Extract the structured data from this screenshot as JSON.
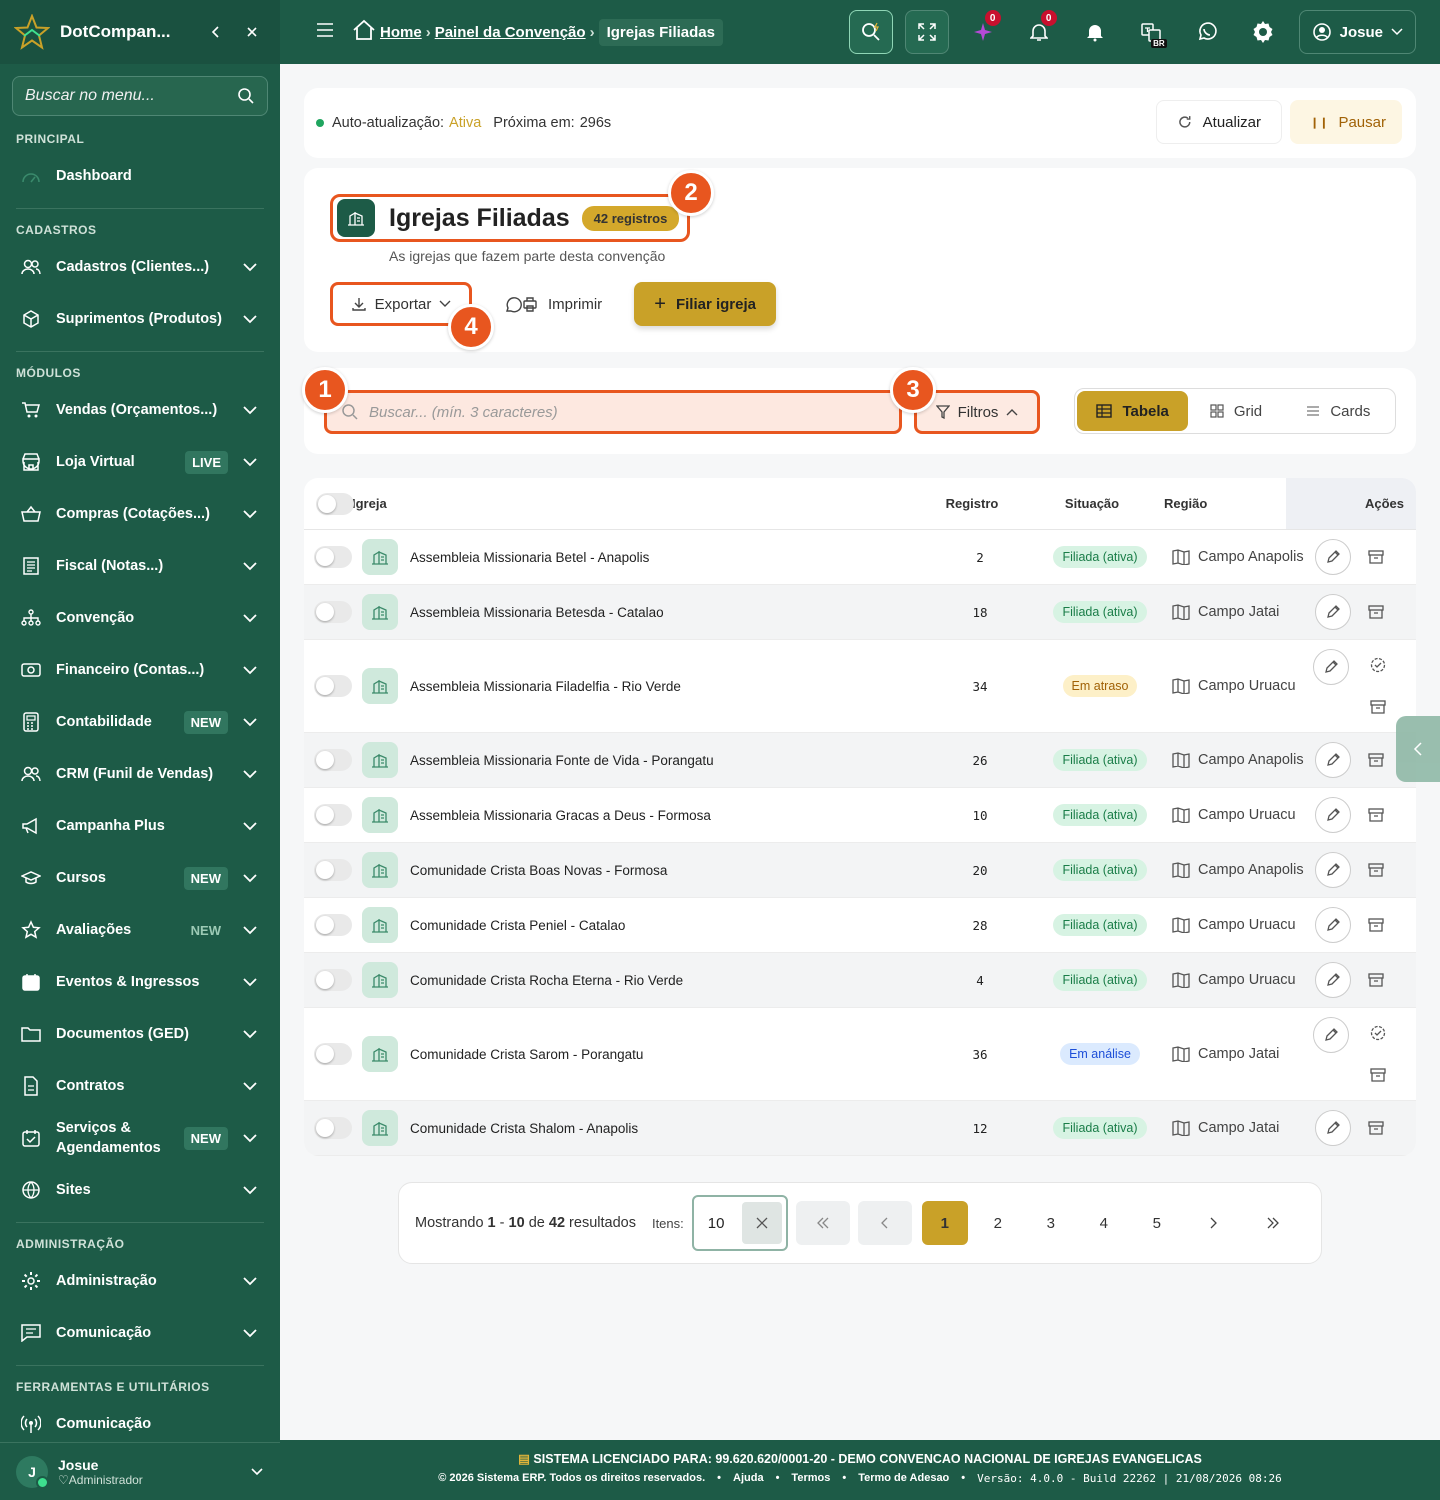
{
  "sidebar": {
    "brand": "DotCompan...",
    "search_placeholder": "Buscar no menu...",
    "sections": {
      "principal": "PRINCIPAL",
      "cadastros": "CADASTROS",
      "modulos": "MÓDULOS",
      "administracao": "ADMINISTRAÇÃO",
      "ferramentas": "FERRAMENTAS E UTILITÁRIOS"
    },
    "items": {
      "dashboard": "Dashboard",
      "cadastros": "Cadastros (Clientes...)",
      "suprimentos": "Suprimentos (Produtos)",
      "vendas": "Vendas (Orçamentos...)",
      "loja": "Loja Virtual",
      "compras": "Compras (Cotações...)",
      "fiscal": "Fiscal (Notas...)",
      "convencao": "Convenção",
      "financeiro": "Financeiro (Contas...)",
      "contabilidade": "Contabilidade",
      "crm": "CRM (Funil de Vendas)",
      "campanha": "Campanha Plus",
      "cursos": "Cursos",
      "avaliacoes": "Avaliações",
      "eventos": "Eventos & Ingressos",
      "documentos": "Documentos (GED)",
      "contratos": "Contratos",
      "servicos": "Serviços & Agendamentos",
      "sites": "Sites",
      "administracao": "Administração",
      "comunicacao": "Comunicação",
      "comunicacao2": "Comunicação"
    },
    "badges": {
      "live": "LIVE",
      "new": "NEW"
    },
    "user": {
      "initial": "J",
      "name": "Josue",
      "role": "Administrador"
    }
  },
  "topbar": {
    "breadcrumb": {
      "home": "Home",
      "painel": "Painel da Convenção",
      "current": "Igrejas Filiadas"
    },
    "counts": {
      "ai": "0",
      "notif": "0"
    },
    "lang": "BR",
    "user": "Josue"
  },
  "refresh": {
    "label": "Auto-atualização:",
    "status": "Ativa",
    "next_label": "Próxima em:",
    "next_value": "296s",
    "update_btn": "Atualizar",
    "pause_btn": "Pausar"
  },
  "header": {
    "title": "Igrejas Filiadas",
    "count_badge": "42 registros",
    "subtitle": "As igrejas que fazem parte desta convenção",
    "export_btn": "Exportar",
    "print_btn": "Imprimir",
    "add_btn": "Filiar igreja"
  },
  "callouts": {
    "n1": "1",
    "n2": "2",
    "n3": "3",
    "n4": "4"
  },
  "filters": {
    "search_placeholder": "Buscar... (mín. 3 caracteres)",
    "filter_btn": "Filtros",
    "views": {
      "table": "Tabela",
      "grid": "Grid",
      "cards": "Cards"
    }
  },
  "table": {
    "headers": {
      "igreja": "Igreja",
      "registro": "Registro",
      "situacao": "Situação",
      "regiao": "Região",
      "acoes": "Ações"
    },
    "rows": [
      {
        "name": "Assembleia Missionaria Betel - Anapolis",
        "reg": "2",
        "status": "Filiada (ativa)",
        "region": "Campo Anapolis"
      },
      {
        "name": "Assembleia Missionaria Betesda - Catalao",
        "reg": "18",
        "status": "Filiada (ativa)",
        "region": "Campo Jatai"
      },
      {
        "name": "Assembleia Missionaria Filadelfia - Rio Verde",
        "reg": "34",
        "status": "Em atraso",
        "region": "Campo Uruacu"
      },
      {
        "name": "Assembleia Missionaria Fonte de Vida - Porangatu",
        "reg": "26",
        "status": "Filiada (ativa)",
        "region": "Campo Anapolis"
      },
      {
        "name": "Assembleia Missionaria Gracas a Deus - Formosa",
        "reg": "10",
        "status": "Filiada (ativa)",
        "region": "Campo Uruacu"
      },
      {
        "name": "Comunidade Crista Boas Novas - Formosa",
        "reg": "20",
        "status": "Filiada (ativa)",
        "region": "Campo Anapolis"
      },
      {
        "name": "Comunidade Crista Peniel - Catalao",
        "reg": "28",
        "status": "Filiada (ativa)",
        "region": "Campo Uruacu"
      },
      {
        "name": "Comunidade Crista Rocha Eterna - Rio Verde",
        "reg": "4",
        "status": "Filiada (ativa)",
        "region": "Campo Uruacu"
      },
      {
        "name": "Comunidade Crista Sarom - Porangatu",
        "reg": "36",
        "status": "Em análise",
        "region": "Campo Jatai"
      },
      {
        "name": "Comunidade Crista Shalom - Anapolis",
        "reg": "12",
        "status": "Filiada (ativa)",
        "region": "Campo Jatai"
      }
    ]
  },
  "pagination": {
    "showing": "Mostrando",
    "from": "1",
    "dash": "-",
    "to": "10",
    "of": "de",
    "total": "42",
    "results": "resultados",
    "items_label": "Itens:",
    "page_size": "10",
    "pages": [
      "1",
      "2",
      "3",
      "4",
      "5"
    ]
  },
  "footer": {
    "license_label": "SISTEMA LICENCIADO PARA:",
    "license_value": "99.620.620/0001-20 - DEMO CONVENCAO NACIONAL DE IGREJAS EVANGELICAS",
    "copyright": "© 2026 Sistema ERP. Todos os direitos reservados.",
    "ajuda": "Ajuda",
    "termos": "Termos",
    "adesao": "Termo de Adesao",
    "version": "Versão: 4.0.0 - Build 22262 | 21/08/2026 08:26"
  },
  "colors": {
    "primary": "#1d5b47",
    "accent": "#c9a128",
    "callout": "#e8561f"
  }
}
